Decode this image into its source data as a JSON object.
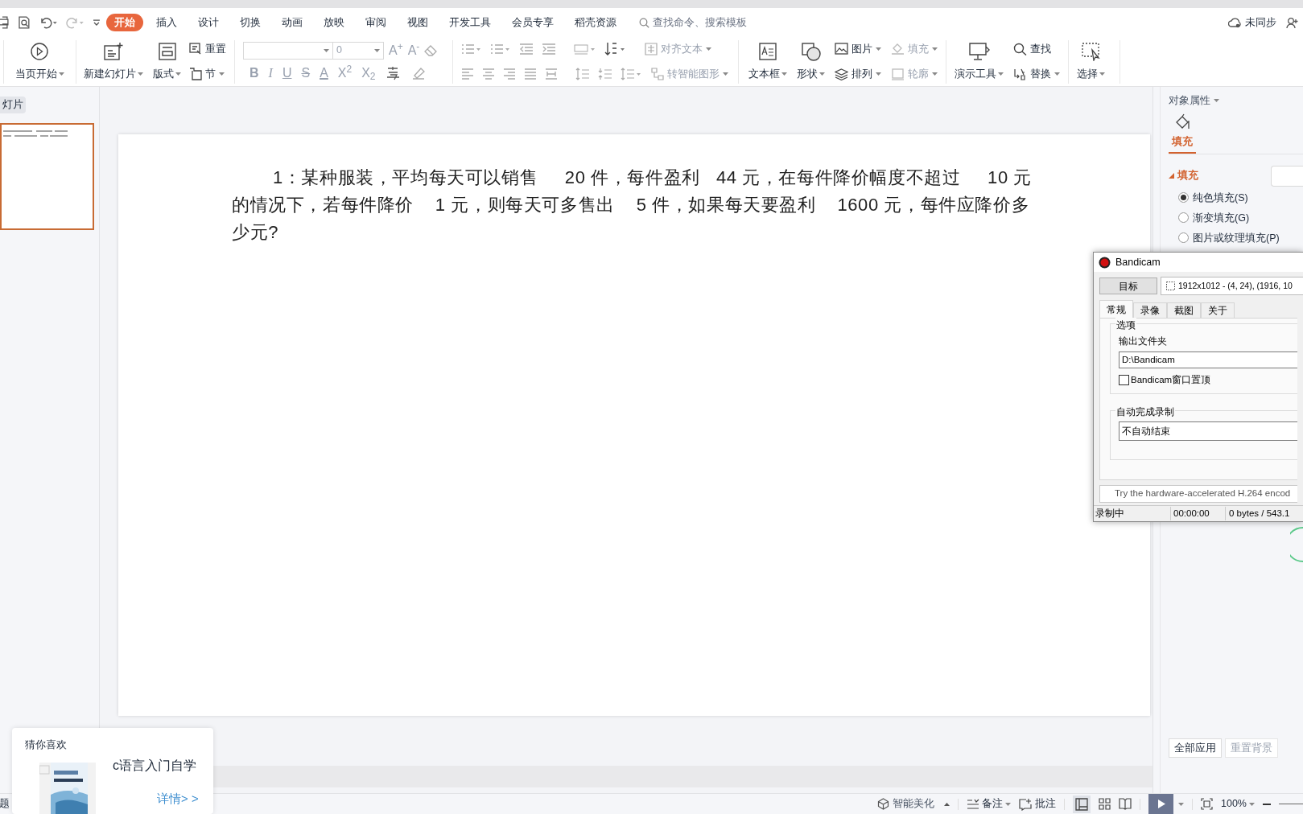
{
  "menu_tabs": [
    {
      "label": "开始",
      "selected": true
    },
    {
      "label": "插入",
      "selected": false
    },
    {
      "label": "设计",
      "selected": false
    },
    {
      "label": "切换",
      "selected": false
    },
    {
      "label": "动画",
      "selected": false
    },
    {
      "label": "放映",
      "selected": false
    },
    {
      "label": "审阅",
      "selected": false
    },
    {
      "label": "视图",
      "selected": false
    },
    {
      "label": "开发工具",
      "selected": false
    },
    {
      "label": "会员专享",
      "selected": false
    },
    {
      "label": "稻壳资源",
      "selected": false
    }
  ],
  "search": {
    "placeholder": "查找命令、搜索模板"
  },
  "sync_status": "未同步",
  "ribbon": [
    {
      "label": "当页开始",
      "disabled": false
    },
    {
      "label": "新建幻灯片",
      "disabled": false
    },
    {
      "label": "版式",
      "disabled": false
    },
    {
      "label": "重置",
      "disabled": false
    },
    {
      "label": "节",
      "disabled": false
    },
    {
      "label": "对齐文本",
      "disabled": true
    },
    {
      "label": "转智能图形",
      "disabled": true
    },
    {
      "label": "文本框",
      "disabled": false
    },
    {
      "label": "形状",
      "disabled": false
    },
    {
      "label": "图片",
      "disabled": false
    },
    {
      "label": "排列",
      "disabled": false
    },
    {
      "label": "填充",
      "disabled": true
    },
    {
      "label": "轮廓",
      "disabled": true
    },
    {
      "label": "演示工具",
      "disabled": false
    },
    {
      "label": "查找",
      "disabled": false
    },
    {
      "label": "替换",
      "disabled": false
    },
    {
      "label": "选择",
      "disabled": false
    }
  ],
  "font_size": {
    "value": "0"
  },
  "font_buttons": [
    "A$^{+}$",
    "A$^{-}$",
    "B",
    "I",
    "U",
    "S",
    "A",
    "X$^{2}$",
    "X$_{2}$"
  ],
  "slides_pane": {
    "tab": "灯片"
  },
  "slide": {
    "text": "1：某种服装，平均每天可以销售     20 件，每件盈利   44 元，在每件降价幅度不超过     10 元的情况下，若每件降价    1 元，则每天可多售出    5 件，如果每天要盈利    1600 元，每件应降价多少元?"
  },
  "properties": {
    "title": "对象属性",
    "tabs": [
      {
        "label": "填充",
        "selected": true
      }
    ],
    "section": {
      "label": "填充",
      "expanded": true
    },
    "options": [
      {
        "label": "纯色填充(S)",
        "selected": true
      },
      {
        "label": "渐变填充(G)",
        "selected": false
      },
      {
        "label": "图片或纹理填充(P)",
        "selected": false
      }
    ],
    "buttons": [
      {
        "label": "全部应用",
        "disabled": false
      },
      {
        "label": "重置背景",
        "disabled": true
      }
    ]
  },
  "bandicam": {
    "title": "Bandicam",
    "target_button": "目标",
    "target_area": "1912x1012 - (4, 24), (1916, 10",
    "tabs": [
      {
        "label": "常规",
        "selected": true
      },
      {
        "label": "录像",
        "selected": false
      },
      {
        "label": "截图",
        "selected": false
      },
      {
        "label": "关于",
        "selected": false
      }
    ],
    "options_group": "选项",
    "output_label": "输出文件夹",
    "output_path": "D:\\Bandicam",
    "topmost": {
      "label": "Bandicam窗口置顶",
      "checked": false
    },
    "auto_group": "自动完成录制",
    "auto_value": "不自动结束",
    "banner": "Try the hardware-accelerated H.264 encod",
    "status": [
      "录制中",
      "00:00:00",
      "0 bytes / 543.1"
    ]
  },
  "recommend": {
    "title": "猜你喜欢",
    "item": "c语言入门自学",
    "link": "详情> >"
  },
  "status_bar": {
    "left": "题",
    "beautify": "智能美化",
    "notes": "备注",
    "comments": "批注",
    "zoom": "100%"
  }
}
